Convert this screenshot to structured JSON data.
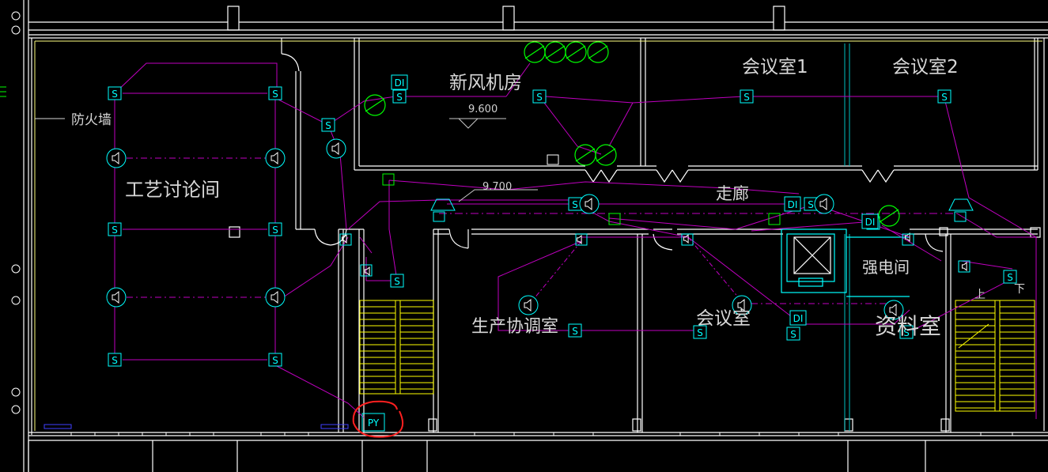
{
  "colors": {
    "background": "#000000",
    "wall": "#ffffff",
    "wire": "#c000c0",
    "device": "#00ffff",
    "fan": "#00ff00",
    "stair": "#ffff00",
    "label": "#d8d8d8",
    "annotation_circle": "#ff2020"
  },
  "labels": {
    "fire_wall": "防火墙",
    "fresh_air_room": "新风机房",
    "meeting_room_1": "会议室1",
    "meeting_room_2": "会议室2",
    "corridor": "走廊",
    "process_discussion_room": "工艺讨论间",
    "production_coordination_room": "生产协调室",
    "meeting_room": "会议室",
    "strong_electric_room": "强电间",
    "archive_room": "资料室",
    "elevation_1": "9.600",
    "elevation_2": "9.700",
    "stair_up": "上",
    "stair_down": "下"
  },
  "device_codes": {
    "smoke_detector": "S",
    "damper": "DI",
    "exhaust_fan": "PY"
  },
  "icons": {
    "smoke_detector": "smoke-detector-icon",
    "speaker": "speaker-icon",
    "fan": "fan-icon",
    "damper": "damper-icon",
    "alarm_bell": "alarm-bell-icon",
    "manual_button": "manual-button-icon",
    "elevator": "elevator-icon",
    "exhaust_fan": "exhaust-fan-icon"
  }
}
